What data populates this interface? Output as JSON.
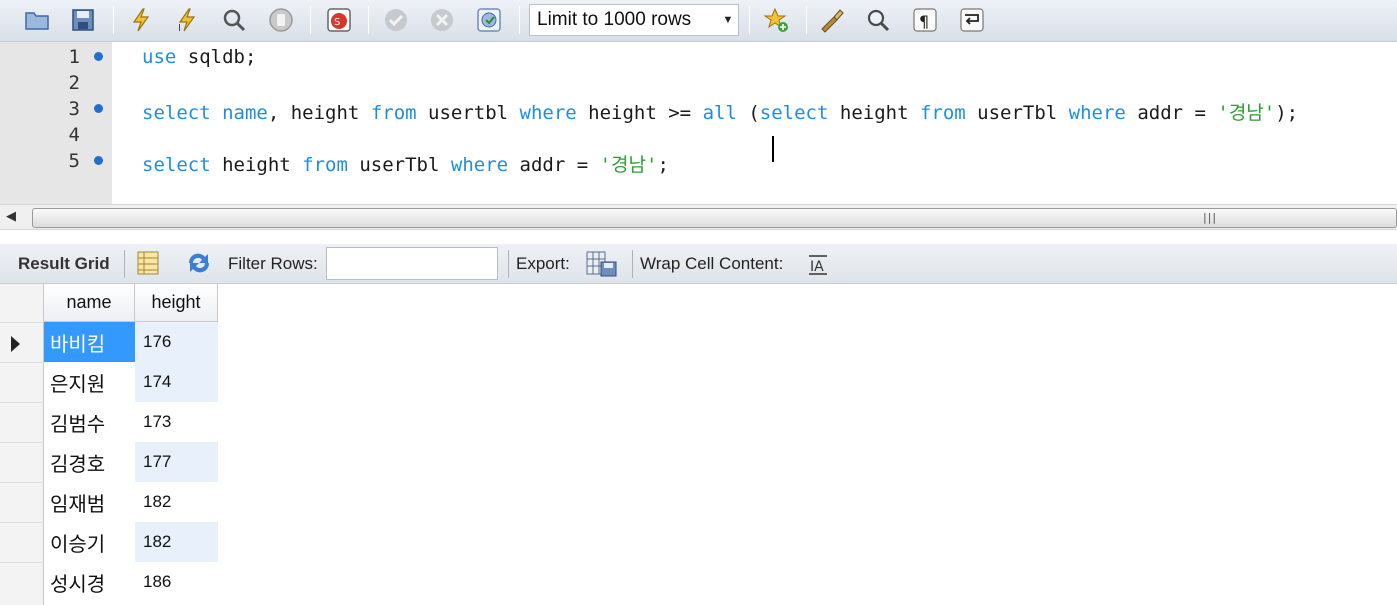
{
  "toolbar": {
    "buttons": [
      "open-folder-icon",
      "save-icon",
      "execute-icon",
      "execute-current-icon",
      "explain-icon",
      "stop-icon",
      "stop-on-error-icon",
      "commit-icon",
      "rollback-icon",
      "autocommit-icon",
      "add-snippet-icon",
      "beautify-icon",
      "find-icon",
      "invisible-chars-icon",
      "wrap-lines-icon"
    ],
    "limit_value": "Limit to 1000 rows"
  },
  "editor": {
    "lines": [
      {
        "no": "1",
        "marker": true
      },
      {
        "no": "2",
        "marker": false
      },
      {
        "no": "3",
        "marker": true
      },
      {
        "no": "4",
        "marker": false
      },
      {
        "no": "5",
        "marker": true
      }
    ],
    "line1": {
      "kw_use": "use",
      "rest": " sqldb;"
    },
    "line3": {
      "t1": "select",
      "t2": " ",
      "t3": "name",
      "t4": ", height ",
      "t5": "from",
      "t6": " usertbl ",
      "t7": "where",
      "t8": " height >= ",
      "t9": "all",
      "t10": " (",
      "t11": "select",
      "t12": " height ",
      "t13": "from",
      "t14": " userTbl ",
      "t15": "where",
      "t16": " addr = ",
      "t17": "'경남'",
      "t18": ");"
    },
    "line5": {
      "t1": "select",
      "t2": " height ",
      "t3": "from",
      "t4": " userTbl ",
      "t5": "where",
      "t6": " addr = ",
      "t7": "'경남'",
      "t8": ";"
    }
  },
  "result_toolbar": {
    "result_grid_label": "Result Grid",
    "filter_label": "Filter Rows:",
    "filter_value": "",
    "export_label": "Export:",
    "wrap_label": "Wrap Cell Content:"
  },
  "grid": {
    "columns": [
      "name",
      "height"
    ],
    "rows": [
      {
        "name": "바비킴",
        "height": "176"
      },
      {
        "name": "은지원",
        "height": "174"
      },
      {
        "name": "김범수",
        "height": "173"
      },
      {
        "name": "김경호",
        "height": "177"
      },
      {
        "name": "임재범",
        "height": "182"
      },
      {
        "name": "이승기",
        "height": "182"
      },
      {
        "name": "성시경",
        "height": "186"
      }
    ]
  },
  "colors": {
    "keyword": "#1d8ee8",
    "string": "#2aa035",
    "selection": "#3399ff",
    "alt_row": "#e8f0fb"
  }
}
